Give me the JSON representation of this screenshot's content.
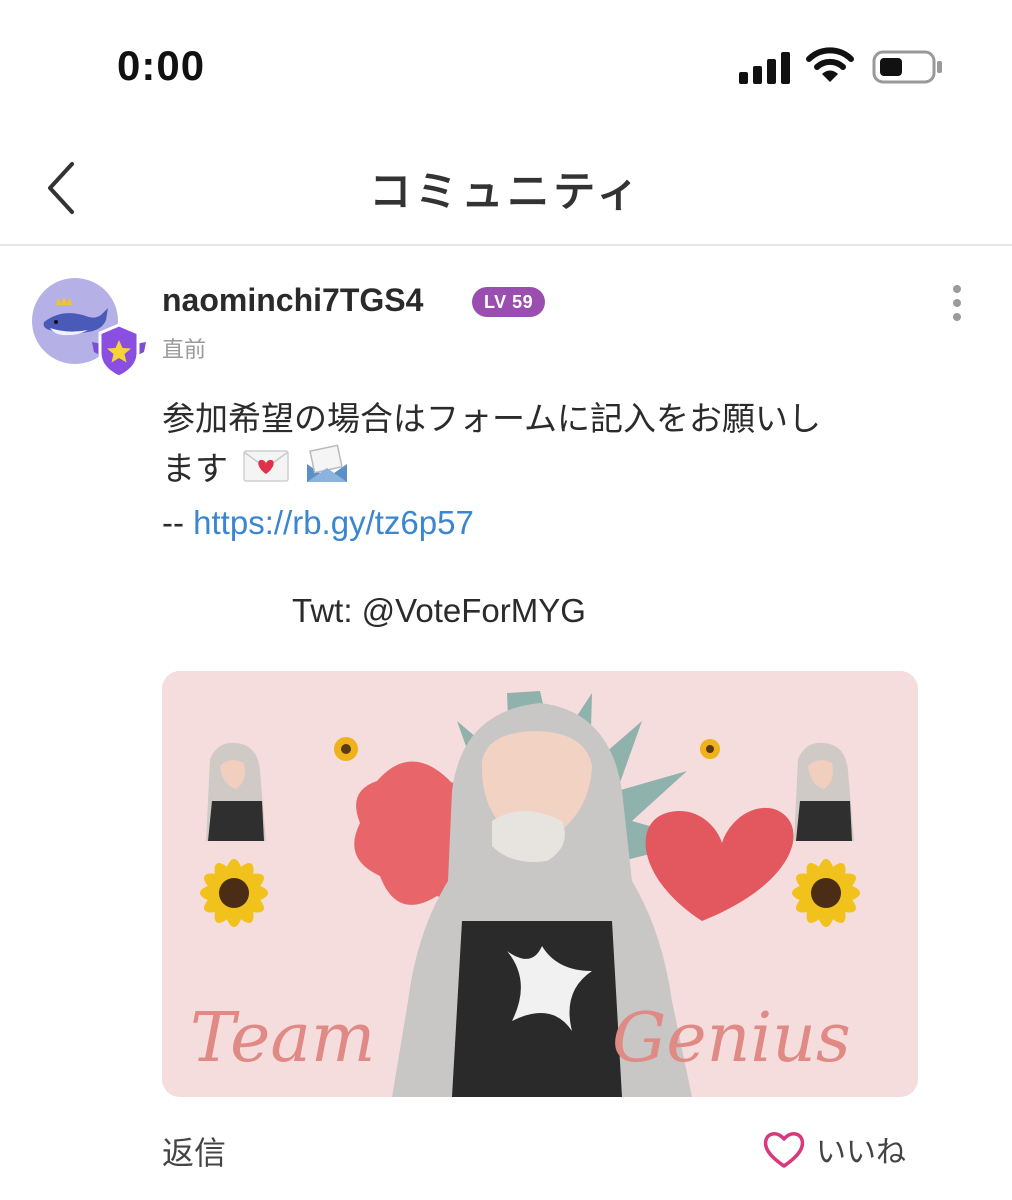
{
  "status_bar": {
    "time": "0:00",
    "icons": [
      "cellular-signal-icon",
      "wifi-icon",
      "battery-icon"
    ]
  },
  "nav": {
    "back_icon": "chevron-left-icon",
    "title": "コミュニティ"
  },
  "post": {
    "username": "naominchi7TGS4",
    "level": "LV 59",
    "timestamp": "直前",
    "text_line1": "参加希望の場合はフォームに記入をお願いし",
    "text_line2": "ます",
    "emojis": [
      "love-letter-emoji",
      "incoming-envelope-emoji"
    ],
    "link_prefix": "-- ",
    "link_text": "https://rb.gy/tz6p57",
    "twitter_line": "Twt: @VoteForMYG",
    "image_script_left": "Team",
    "image_script_right": "Genius",
    "actions": {
      "reply": "返信",
      "like": "いいね"
    }
  },
  "colors": {
    "level_badge": "#9a4fb0",
    "link": "#3b86d1",
    "like_heart": "#d63a7c",
    "avatar_bg": "#b5b0e6",
    "shield": "#8a4fe0"
  }
}
